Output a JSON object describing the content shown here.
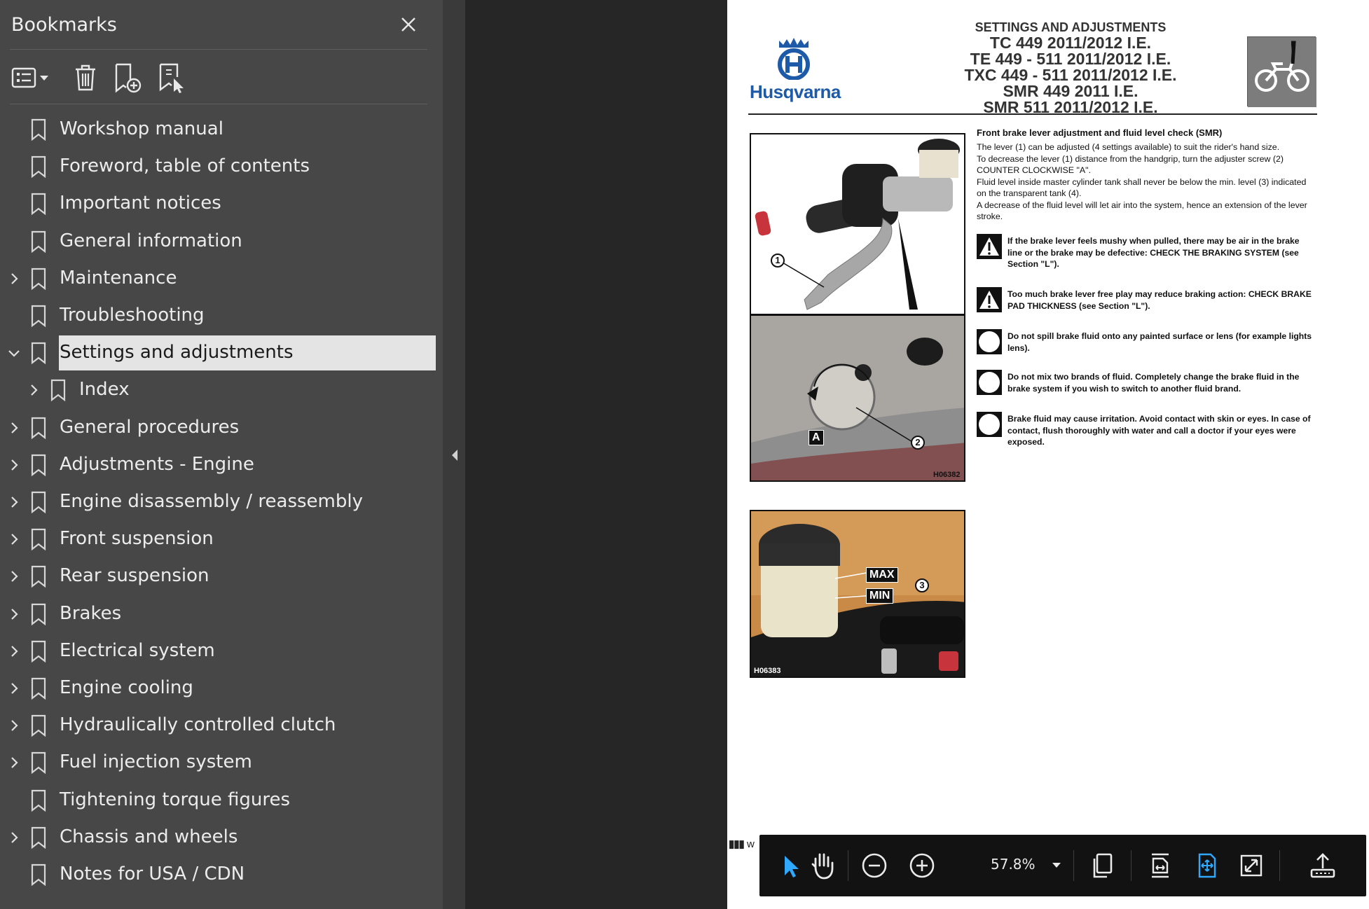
{
  "bookmarks": {
    "title": "Bookmarks",
    "items": [
      {
        "label": "Workshop manual",
        "expandable": false
      },
      {
        "label": "Foreword, table of contents",
        "expandable": false
      },
      {
        "label": "Important notices",
        "expandable": false
      },
      {
        "label": "General information",
        "expandable": false
      },
      {
        "label": "Maintenance",
        "expandable": true
      },
      {
        "label": "Troubleshooting",
        "expandable": false
      },
      {
        "label": "Settings and adjustments",
        "expandable": true,
        "expanded": true,
        "selected": true
      },
      {
        "label": "Index",
        "expandable": true,
        "child": true
      },
      {
        "label": "General procedures",
        "expandable": true
      },
      {
        "label": "Adjustments - Engine",
        "expandable": true
      },
      {
        "label": "Engine disassembly / reassembly",
        "expandable": true
      },
      {
        "label": "Front suspension",
        "expandable": true
      },
      {
        "label": "Rear suspension",
        "expandable": true
      },
      {
        "label": "Brakes",
        "expandable": true
      },
      {
        "label": "Electrical system",
        "expandable": true
      },
      {
        "label": "Engine cooling",
        "expandable": true
      },
      {
        "label": "Hydraulically controlled clutch",
        "expandable": true
      },
      {
        "label": "Fuel injection system",
        "expandable": true
      },
      {
        "label": "Tightening torque figures",
        "expandable": false
      },
      {
        "label": "Chassis and wheels",
        "expandable": true
      },
      {
        "label": "Notes for USA / CDN",
        "expandable": false
      }
    ]
  },
  "document": {
    "brand": "Husqvarna",
    "header_lines": [
      "SETTINGS AND ADJUSTMENTS",
      "TC 449 2011/2012 I.E.",
      "TE 449 - 511 2011/2012 I.E.",
      "TXC 449 - 511 2011/2012 I.E.",
      "SMR 449 2011 I.E.",
      "SMR 511 2011/2012 I.E."
    ],
    "section_title": "Front brake lever adjustment and fluid level check (SMR)",
    "body": [
      "The lever (1) can be adjusted (4 settings available) to suit the rider's hand size.",
      "To decrease the lever (1) distance from the handgrip, turn the adjuster screw (2) COUNTER CLOCKWISE \"A\".",
      "Fluid level inside master cylinder tank shall never be below the min. level (3) indicated on the transparent tank (4).",
      "A decrease of the fluid level will let air into the system, hence an extension of the lever stroke."
    ],
    "notes": [
      {
        "icon": "warning",
        "text": "If the brake lever feels mushy when pulled, there may be air in the brake line or the brake may be defective: CHECK THE BRAKING SYSTEM (see Section \"L\")."
      },
      {
        "icon": "warning",
        "text": "Too much brake lever free play may reduce braking action: CHECK BRAKE PAD THICKNESS (see Section \"L\")."
      },
      {
        "icon": "circle",
        "text": "Do not spill brake fluid onto any painted surface or lens (for example lights lens)."
      },
      {
        "icon": "circle",
        "text": "Do not mix two brands of fluid. Completely change the brake fluid in the brake system if you wish to switch to another fluid brand."
      },
      {
        "icon": "circle",
        "text": "Brake fluid may cause irritation. Avoid contact with skin or eyes. In case of contact, flush thoroughly with water and call a doctor if your eyes were exposed."
      }
    ],
    "photo1_code": "H06382",
    "photo2_code": "H06383",
    "callout_1": "1",
    "callout_2": "2",
    "callout_3": "3",
    "label_a": "A",
    "label_max": "MAX",
    "label_min": "MIN",
    "edge_text": "w"
  },
  "toolbar": {
    "zoom": "57.8%",
    "active_tool": "select",
    "accent": "#2fa8ff"
  },
  "colors": {
    "panel_bg": "#474747",
    "selection_bg": "#e4e4e4",
    "brand_blue": "#1d5aa8",
    "toolbar_bg": "#121212"
  }
}
